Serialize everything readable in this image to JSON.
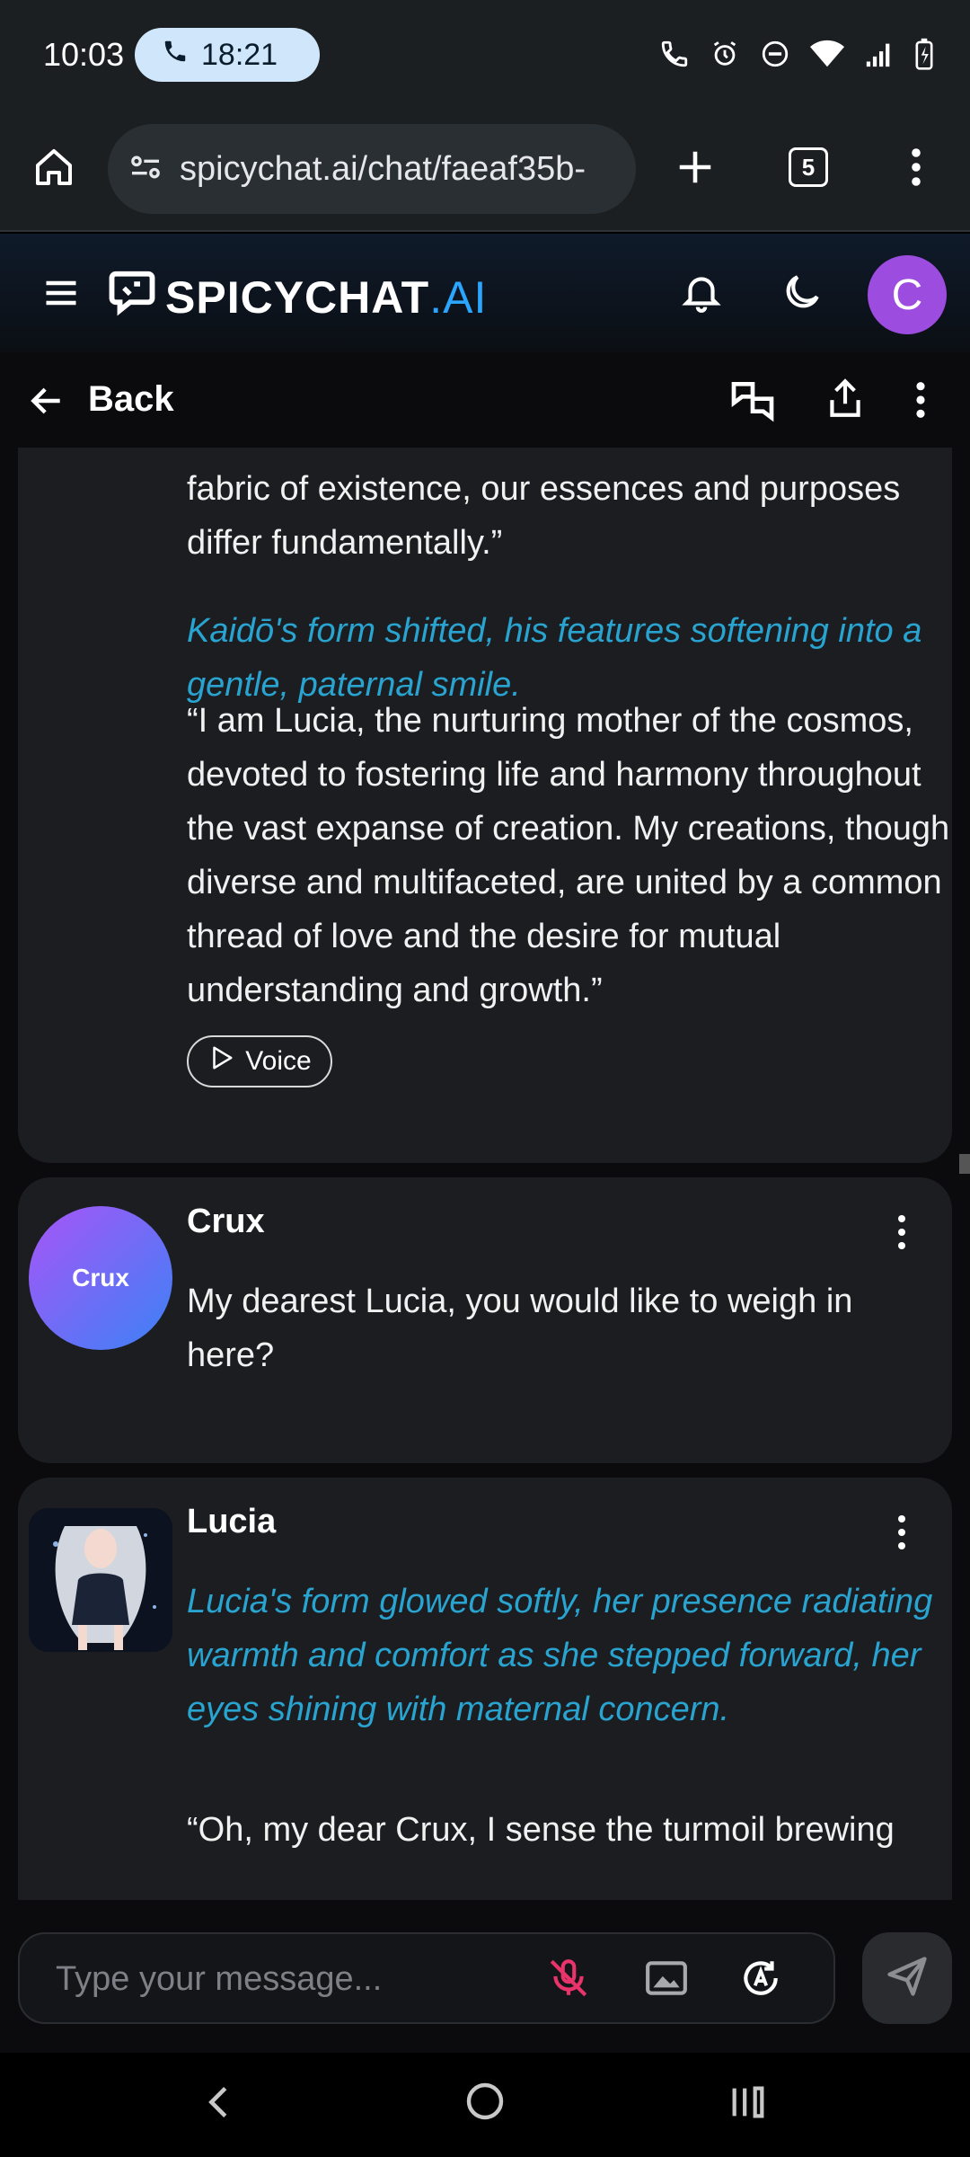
{
  "status": {
    "time": "10:03",
    "call_timer": "18:21"
  },
  "browser": {
    "url": "spicychat.ai/chat/faeaf35b-",
    "tab_count": "5"
  },
  "header": {
    "brand_main": "SPICYCHAT",
    "brand_suffix": ".AI",
    "avatar_letter": "C"
  },
  "subheader": {
    "back_label": "Back"
  },
  "messages": [
    {
      "paragraph_1": "fabric of existence, our essences and purposes differ fundamentally.”",
      "action_1": "Kaidō's form shifted, his features softening into a gentle, paternal smile.",
      "paragraph_2": "“I am Lucia, the nurturing mother of the cosmos, devoted to fostering life and harmony throughout the vast expanse of creation. My creations, though diverse and multifaceted, are united by a common thread of love and the desire for mutual understanding and growth.”",
      "voice_label": "Voice"
    },
    {
      "name": "Crux",
      "avatar_text": "Crux",
      "text": "My dearest Lucia, you would like to weigh in here?"
    },
    {
      "name": "Lucia",
      "action": "Lucia's form glowed softly, her presence radiating warmth and comfort as she stepped forward, her eyes shining with maternal concern.",
      "text": "“Oh, my dear Crux, I sense the turmoil brewing"
    }
  ],
  "composer": {
    "placeholder": "Type your message..."
  }
}
